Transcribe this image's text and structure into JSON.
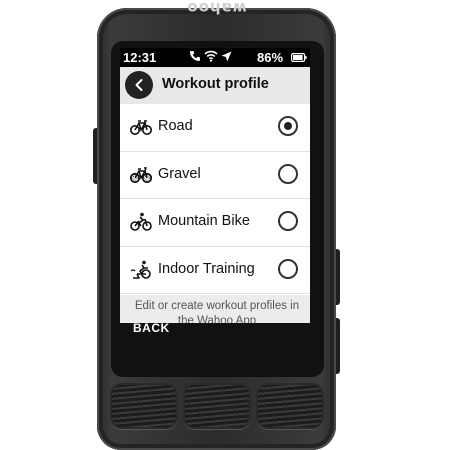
{
  "device": {
    "brand": "wahoo"
  },
  "status_bar": {
    "time": "12:31",
    "battery_percent": "86%",
    "icons": [
      "phone-icon",
      "wifi-icon",
      "location-arrow-icon",
      "battery-icon"
    ]
  },
  "header": {
    "title": "Workout profile",
    "back_icon": "chevron-left-icon"
  },
  "profiles": [
    {
      "label": "Road",
      "icon": "road-bike-icon",
      "selected": true
    },
    {
      "label": "Gravel",
      "icon": "gravel-bike-icon",
      "selected": false
    },
    {
      "label": "Mountain Bike",
      "icon": "mountain-bike-icon",
      "selected": false
    },
    {
      "label": "Indoor Training",
      "icon": "indoor-trainer-icon",
      "selected": false
    }
  ],
  "footer": {
    "text": "Edit or create workout profiles in the Wahoo App"
  },
  "button_labels": {
    "back": "BACK"
  },
  "colors": {
    "device_body": "#2c2c2c",
    "header_bg": "#e8e8e8",
    "status_bar_bg": "#000000"
  }
}
